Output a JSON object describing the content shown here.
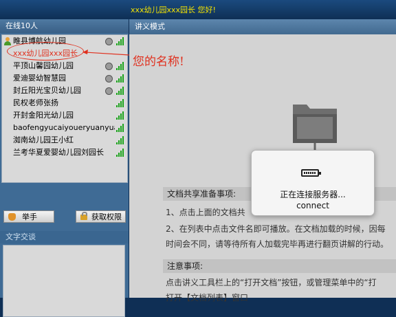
{
  "greeting": "xxx幼儿园xxx园长 您好!",
  "sidebar": {
    "online_title": "在线10人",
    "users": [
      {
        "name": "睢县博航幼儿园",
        "host": true,
        "camera": true,
        "signal": true
      },
      {
        "name": "xxx幼儿园xxx园长",
        "self": true
      },
      {
        "name": "平顶山馨园幼儿园",
        "camera": true,
        "signal": true
      },
      {
        "name": "爱迪婴幼智慧园",
        "camera": true,
        "signal": true
      },
      {
        "name": "封丘阳光宝贝幼儿园",
        "camera": true,
        "signal": true
      },
      {
        "name": "民权老师张扬",
        "signal": true
      },
      {
        "name": "开封金阳光幼儿园",
        "signal": true
      },
      {
        "name": "baofengyucaiyoueryuanyuanzhang",
        "signal": true
      },
      {
        "name": "洳南幼儿园王小红",
        "signal": true
      },
      {
        "name": "兰考华夏爱婴幼儿园刘园长",
        "signal": true
      }
    ],
    "raise_hand_label": "举手",
    "get_permission_label": "获取权限",
    "chat_title": "文字交谈"
  },
  "main": {
    "mode_title": "讲义模式",
    "section1_title": "文档共享准备事项:",
    "line1": "1、点击上面的文档共",
    "line2": "2、在列表中点击文件名即可播放。在文档加载的时候，因每",
    "line3": "时间会不同，请等待所有人加载完毕再进行翻页讲解的行动。",
    "section2_title": "注意事项:",
    "line4": "点击讲义工具栏上的“打开文档”按钮，或管理菜单中的“打",
    "line5": "打开【文档列表】窗口"
  },
  "modal": {
    "status": "正在连接服务器...",
    "sub": "connect"
  },
  "annotation": "您的名称!",
  "colors": {
    "greeting": "#f4e300",
    "annotation": "#e0301e",
    "signal": "#1aa31a"
  }
}
